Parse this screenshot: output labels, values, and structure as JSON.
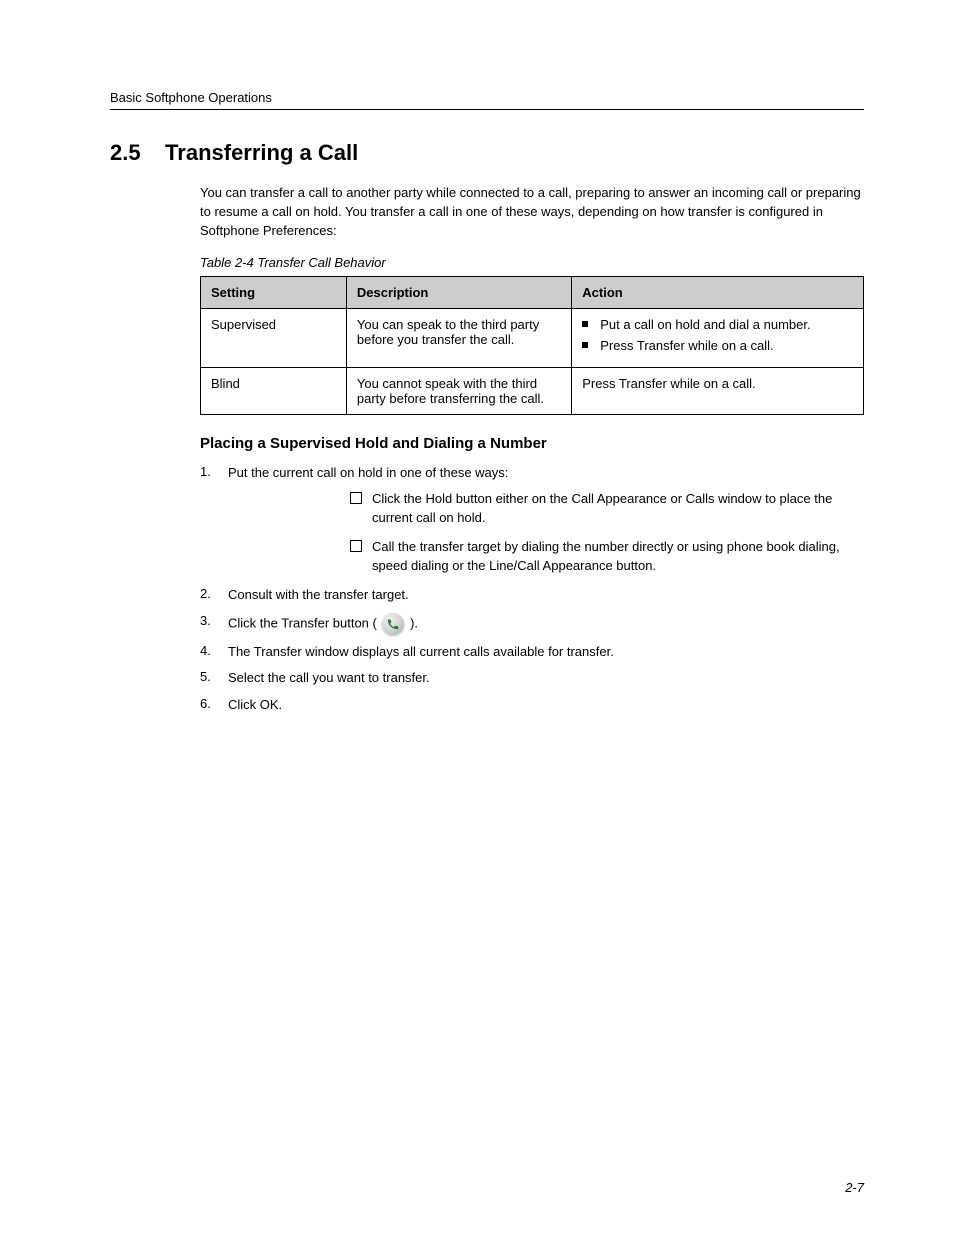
{
  "running_header": "Basic Softphone Operations",
  "section": {
    "number": "2.5",
    "title": "Transferring a Call",
    "intro1": "You can transfer a call to another party while connected to a call, preparing to answer an incoming call or preparing to resume a call on hold. You transfer a call in one of these ways, depending on how transfer is configured in Softphone Preferences:",
    "table_caption": "Table 2-4     Transfer Call Behavior",
    "table": {
      "headers": [
        "Setting",
        "Description",
        "Action"
      ],
      "rows": [
        {
          "setting": "Supervised",
          "description": "You can speak to the third party before you transfer the call.",
          "actions": [
            "Put a call on hold and dial a number.",
            "Press Transfer while on a call."
          ]
        },
        {
          "setting": "Blind",
          "description": "You cannot speak with the third party before transferring the call.",
          "actions_plain": "Press Transfer while on a call."
        }
      ]
    },
    "sub1": {
      "heading": "Placing a Supervised Hold and Dialing a Number",
      "step1_lead": "1.",
      "step1_text_pre": "Put the current call on hold in one of these ways:",
      "step1_items": [
        "Click the Hold button either on the Call Appearance or Calls window to place the current call on hold.",
        "Call the transfer target by dialing the number directly or using phone book dialing, speed dialing or the Line/Call Appearance button."
      ],
      "step2_lead": "2.",
      "step2_text": "Consult with the transfer target.",
      "step3_lead": "3.",
      "step3_text": "Click the Transfer button (",
      "step3_text_after": ").",
      "step4_lead": "4.",
      "step4_text": "The Transfer window displays all current calls available for transfer.",
      "step5_lead": "5.",
      "step5_text": "Select the call you want to transfer.",
      "step6_lead": "6.",
      "step6_text": "Click OK."
    }
  },
  "page_number": "2-7"
}
